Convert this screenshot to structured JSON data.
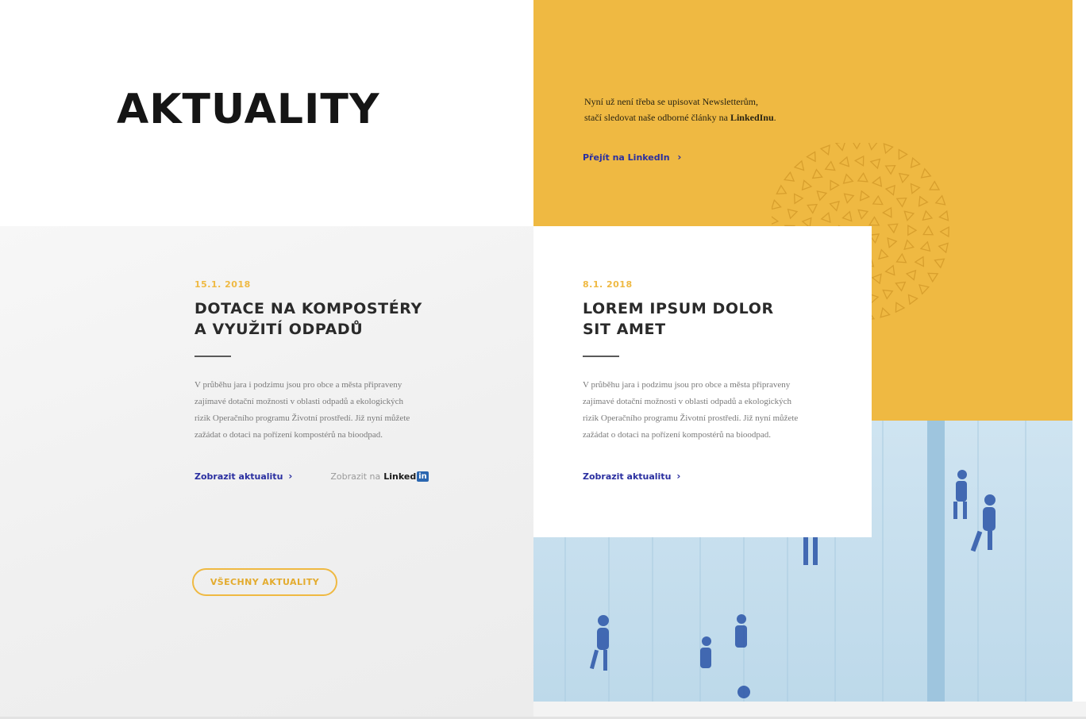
{
  "page": {
    "title": "AKTUALITY"
  },
  "newsletter": {
    "line1": "Nyní už není třeba se upisovat Newsletterům,",
    "line2_prefix": "stačí sledovat naše odborné články na ",
    "line2_brand": "LinkedInu",
    "line2_suffix": ".",
    "link_label": "Přejít na LinkedIn",
    "chevron": "›"
  },
  "articles": [
    {
      "date": "15.1. 2018",
      "title_line1": "DOTACE NA KOMPOSTÉRY",
      "title_line2": "A VYUŽITÍ ODPADŮ",
      "body": [
        "V průběhu jara i podzimu jsou pro obce a města připraveny",
        "zajímavé dotační možnosti v oblasti odpadů a ekologických",
        "rizik Operačního programu Životní prostředí. Již nyní můžete",
        "zažádat o dotaci na pořízení kompostérů na bioodpad."
      ],
      "more_label": "Zobrazit aktualitu",
      "chevron": "›",
      "linkedin_prefix": "Zobrazit na",
      "linkedin_word": "Linked",
      "linkedin_box": "in"
    },
    {
      "date": "8.1. 2018",
      "title_line1": "LOREM IPSUM DOLOR",
      "title_line2": "SIT AMET",
      "body": [
        "V průběhu jara i podzimu jsou pro obce a města připraveny",
        "zajímavé dotační možnosti v oblasti odpadů a ekologických",
        "rizik Operačního programu Životní prostředí. Již nyní můžete",
        "zažádat o dotaci na pořízení kompostérů na bioodpad."
      ],
      "more_label": "Zobrazit aktualitu",
      "chevron": "›"
    }
  ],
  "all_news_button": "VŠECHNY AKTUALITY",
  "colors": {
    "accent_yellow": "#efb942",
    "link_blue": "#2a2fa0",
    "photo_tint": "#bdd9ea"
  },
  "icons": {
    "chevron": "chevron-right-icon",
    "linkedin": "linkedin-logo",
    "pattern": "triangle-pattern-decoration"
  }
}
